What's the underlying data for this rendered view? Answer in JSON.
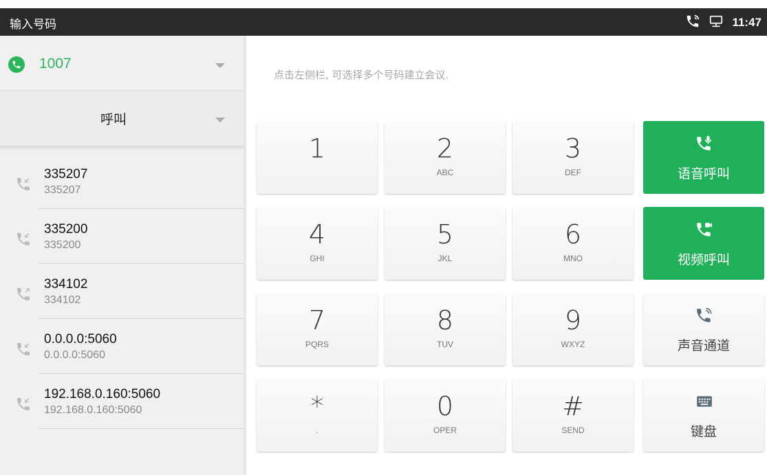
{
  "statusbar": {
    "title": "输入号码",
    "time": "11:47"
  },
  "account": {
    "number": "1007"
  },
  "mode": {
    "label": "呼叫"
  },
  "history": [
    {
      "name": "335207",
      "number": "335207",
      "direction": "incoming"
    },
    {
      "name": "335200",
      "number": "335200",
      "direction": "incoming"
    },
    {
      "name": "334102",
      "number": "334102",
      "direction": "outgoing"
    },
    {
      "name": "0.0.0.0:5060",
      "number": "0.0.0.0:5060",
      "direction": "incoming"
    },
    {
      "name": "192.168.0.160:5060",
      "number": "192.168.0.160:5060",
      "direction": "incoming"
    }
  ],
  "hint": "点击左侧栏, 可选择多个号码建立会议.",
  "keys": [
    {
      "digit": "1",
      "letters": ""
    },
    {
      "digit": "2",
      "letters": "ABC"
    },
    {
      "digit": "3",
      "letters": "DEF"
    },
    {
      "digit": "4",
      "letters": "GHI"
    },
    {
      "digit": "5",
      "letters": "JKL"
    },
    {
      "digit": "6",
      "letters": "MNO"
    },
    {
      "digit": "7",
      "letters": "PQRS"
    },
    {
      "digit": "8",
      "letters": "TUV"
    },
    {
      "digit": "9",
      "letters": "WXYZ"
    },
    {
      "digit": "*",
      "letters": "."
    },
    {
      "digit": "0",
      "letters": "OPER"
    },
    {
      "digit": "#",
      "letters": "SEND"
    }
  ],
  "actions": {
    "voice_call": "语音呼叫",
    "video_call": "视频呼叫",
    "audio_channel": "声音通道",
    "keyboard": "键盘"
  },
  "colors": {
    "accent": "#21b05a",
    "statusbar": "#2a2a2a"
  }
}
